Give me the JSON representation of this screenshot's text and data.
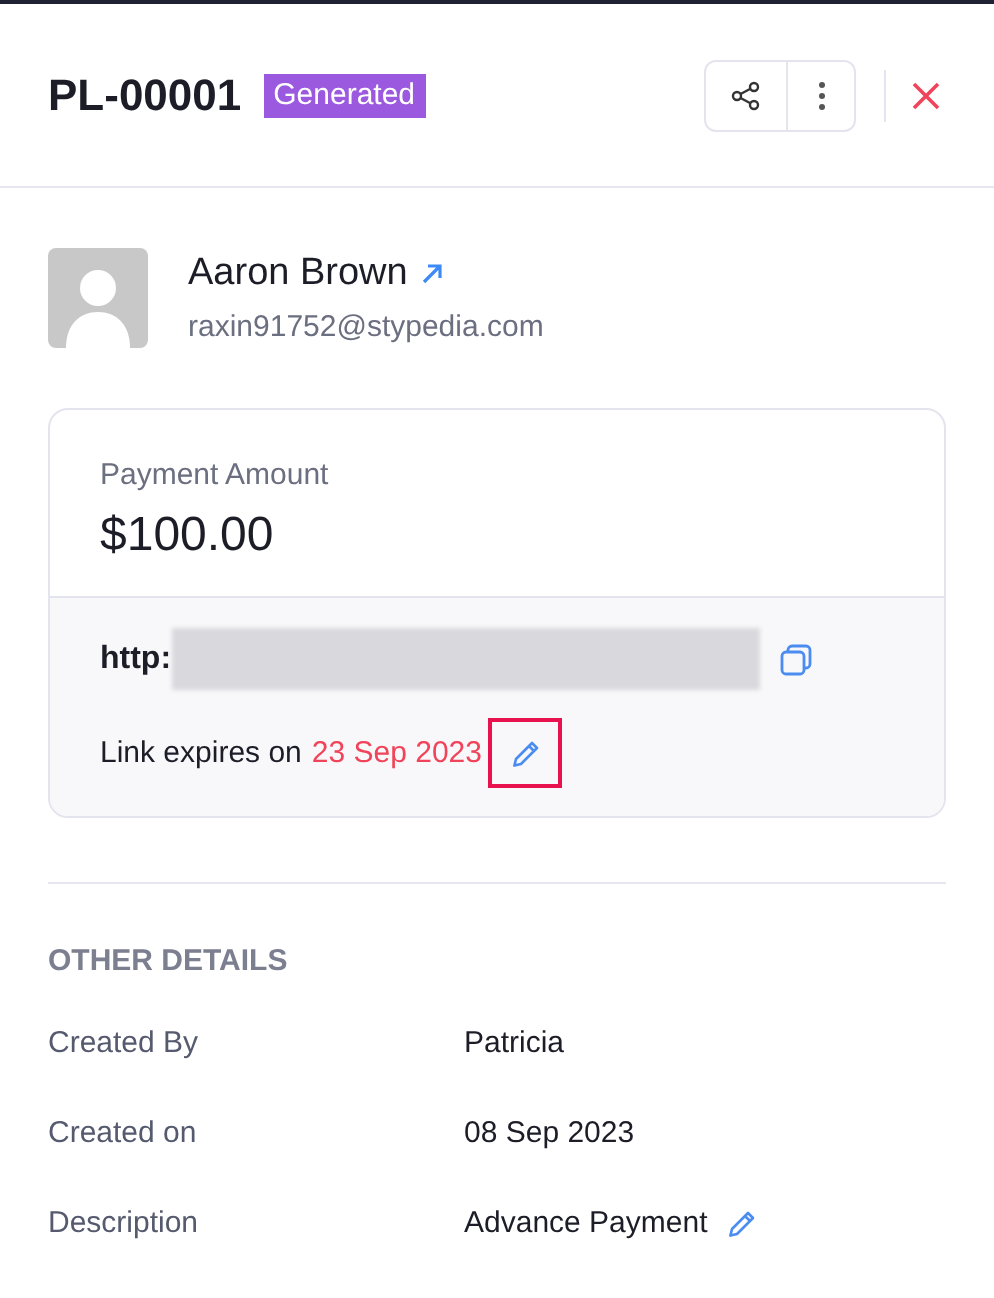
{
  "header": {
    "title": "PL-00001",
    "status": "Generated"
  },
  "customer": {
    "name": "Aaron Brown",
    "email": "raxin91752@stypedia.com"
  },
  "payment": {
    "label": "Payment Amount",
    "amount": "$100.00",
    "link_prefix": "http:",
    "expiry_label": "Link expires on",
    "expiry_date": "23 Sep 2023",
    "edit_highlighted": true
  },
  "other_details": {
    "heading": "OTHER DETAILS",
    "rows": [
      {
        "label": "Created By",
        "value": "Patricia",
        "editable": false
      },
      {
        "label": "Created on",
        "value": "08 Sep 2023",
        "editable": false
      },
      {
        "label": "Description",
        "value": "Advance Payment",
        "editable": true
      }
    ]
  }
}
